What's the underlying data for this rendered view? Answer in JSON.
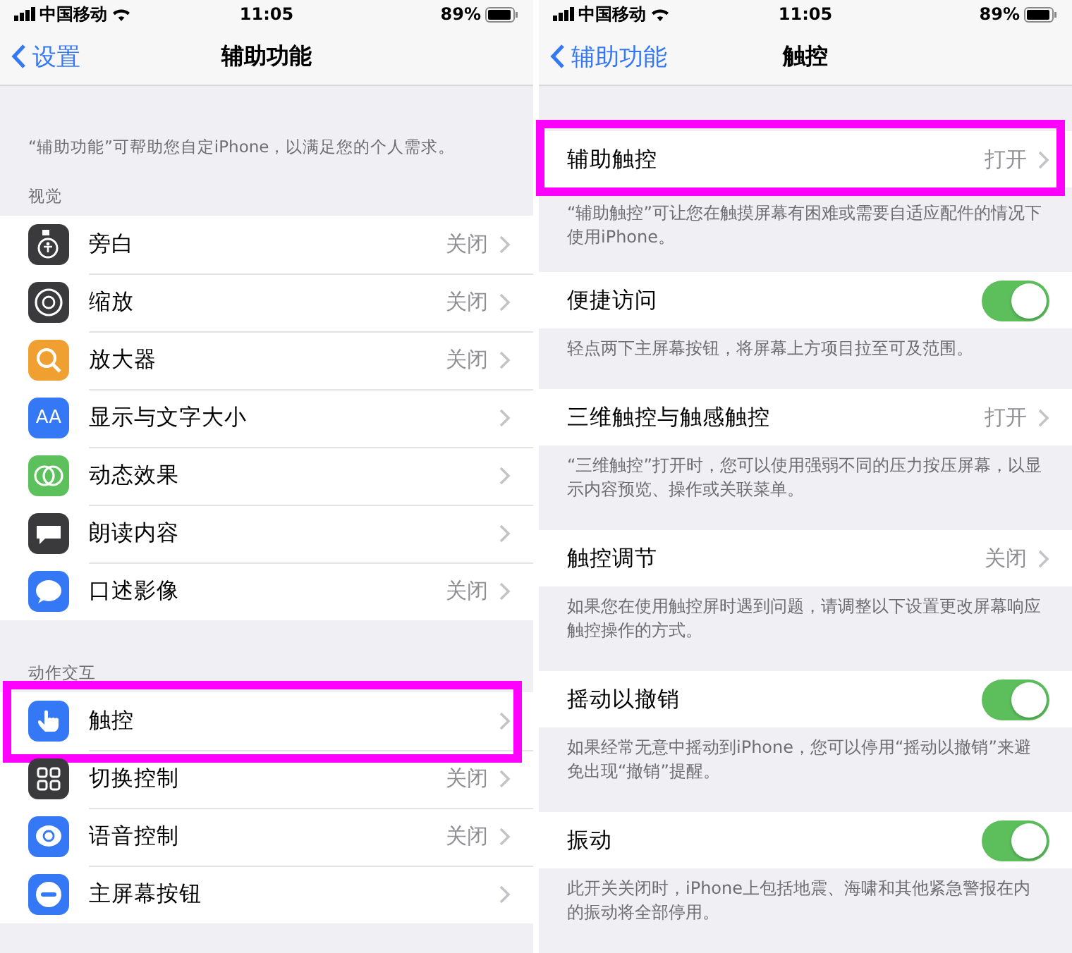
{
  "left": {
    "status_bar": {
      "carrier": "中国移动",
      "time": "11:05",
      "battery": "89%"
    },
    "nav": {
      "back": "设置",
      "title": "辅助功能"
    },
    "description": "“辅助功能”可帮助您自定iPhone，以满足您的个人需求。",
    "sections": [
      {
        "header": "视觉",
        "items": [
          {
            "label": "旁白",
            "value": "关闭",
            "color": "#3a3a3c",
            "highlighted": false
          },
          {
            "label": "缩放",
            "value": "关闭",
            "color": "#3a3a3c",
            "highlighted": false
          },
          {
            "label": "放大器",
            "value": "关闭",
            "color": "#f0a030",
            "highlighted": false
          },
          {
            "label": "显示与文字大小",
            "icon_text": "AA",
            "color": "#3478f6",
            "highlighted": false
          },
          {
            "label": "动态效果",
            "color": "#5cc15c",
            "highlighted": false
          },
          {
            "label": "朗读内容",
            "color": "#3a3a3c",
            "highlighted": false
          },
          {
            "label": "口述影像",
            "value": "关闭",
            "color": "#3478f6",
            "highlighted": false
          }
        ]
      },
      {
        "header": "动作交互",
        "items": [
          {
            "label": "触控",
            "color": "#3478f6",
            "highlighted": true
          },
          {
            "label": "切换控制",
            "value": "关闭",
            "color": "#3a3a3c",
            "highlighted": false
          },
          {
            "label": "语音控制",
            "value": "关闭",
            "color": "#3478f6",
            "highlighted": false
          },
          {
            "label": "主屏幕按钮",
            "color": "#3478f6",
            "highlighted": false
          }
        ]
      }
    ]
  },
  "right": {
    "status_bar": {
      "carrier": "中国移动",
      "time": "11:05",
      "battery": "89%"
    },
    "nav": {
      "back": "辅助功能",
      "title": "触控"
    },
    "groups": [
      {
        "kind": "link",
        "label": "辅助触控",
        "value": "打开",
        "highlighted": true,
        "footer": "“辅助触控”可让您在触摸屏幕有困难或需要自适应配件的情况下使用iPhone。"
      },
      {
        "kind": "toggle",
        "label": "便捷访问",
        "on": true,
        "highlighted": false,
        "footer": "轻点两下主屏幕按钮，将屏幕上方项目拉至可及范围。"
      },
      {
        "kind": "link",
        "label": "三维触控与触感触控",
        "value": "打开",
        "highlighted": false,
        "footer": "“三维触控”打开时，您可以使用强弱不同的压力按压屏幕，以显示内容预览、操作或关联菜单。"
      },
      {
        "kind": "link",
        "label": "触控调节",
        "value": "关闭",
        "highlighted": false,
        "footer": "如果您在使用触控屏时遇到问题，请调整以下设置更改屏幕响应触控操作的方式。"
      },
      {
        "kind": "toggle",
        "label": "摇动以撤销",
        "on": true,
        "highlighted": false,
        "footer": "如果经常无意中摇动到iPhone，您可以停用“摇动以撤销”来避免出现“撤销”提醒。"
      },
      {
        "kind": "toggle",
        "label": "振动",
        "on": true,
        "highlighted": false,
        "footer": "此开关关闭时，iPhone上包括地震、海啸和其他紧急警报在内的振动将全部停用。"
      }
    ]
  }
}
